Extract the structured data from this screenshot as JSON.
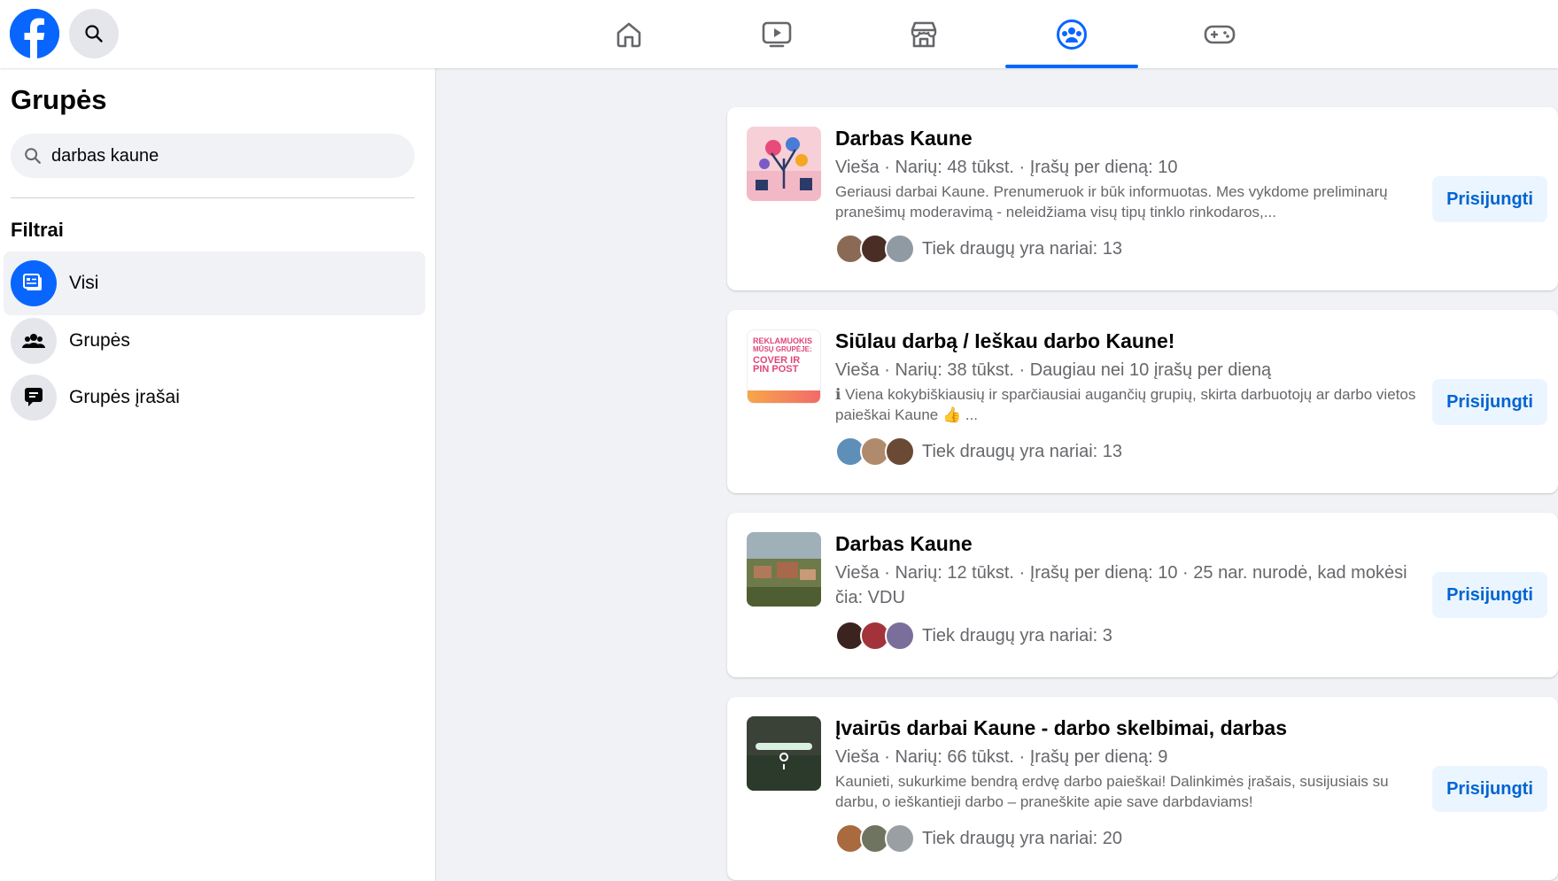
{
  "sidebar": {
    "title": "Grupės",
    "search_value": "darbas kaune",
    "filters_heading": "Filtrai",
    "items": [
      {
        "label": "Visi"
      },
      {
        "label": "Grupės"
      },
      {
        "label": "Grupės įrašai"
      }
    ]
  },
  "results": [
    {
      "title": "Darbas Kaune",
      "meta": "Vieša · Narių: 48 tūkst. · Įrašų per dieną: 10",
      "description": "Geriausi darbai Kaune. Prenumeruok ir būk informuotas. Mes vykdome preliminarų pranešimų moderavimą - neleidžiama visų tipų tinklo rinkodaros,...",
      "friends": "Tiek draugų yra nariai: 13",
      "join_label": "Prisijungti"
    },
    {
      "title": "Siūlau darbą / Ieškau darbo Kaune!",
      "meta": "Vieša · Narių: 38 tūkst. · Daugiau nei 10 įrašų per dieną",
      "description": "ℹ Viena kokybiškiausių ir sparčiausiai augančių grupių, skirta darbuotojų ar darbo vietos paieškai Kaune 👍 ...",
      "friends": "Tiek draugų yra nariai: 13",
      "join_label": "Prisijungti",
      "thumb_text": [
        "REKLAMUOKIS",
        "MŪSŲ GRUPĖJE:",
        "COVER IR",
        "PIN POST"
      ]
    },
    {
      "title": "Darbas Kaune",
      "meta": "Vieša · Narių: 12 tūkst. · Įrašų per dieną: 10 · 25 nar. nurodė, kad mokėsi čia: VDU",
      "friends": "Tiek draugų yra nariai: 3",
      "join_label": "Prisijungti"
    },
    {
      "title": "Įvairūs darbai Kaune - darbo skelbimai, darbas",
      "meta": "Vieša · Narių: 66 tūkst. · Įrašų per dieną: 9",
      "description": "Kaunieti, sukurkime bendrą erdvę darbo paieškai! Dalinkimės įrašais, susijusiais su darbu, o ieškantieji darbo – praneškite apie save darbdaviams!",
      "friends": "Tiek draugų yra nariai: 20",
      "join_label": "Prisijungti"
    }
  ],
  "icons": {
    "logo": "facebook-logo-icon",
    "top_search": "search-icon",
    "nav": [
      "home-icon",
      "video-icon",
      "marketplace-icon",
      "groups-icon",
      "gaming-icon"
    ]
  },
  "colors": {
    "accent": "#0866ff",
    "join_button_bg": "#ebf5ff",
    "join_button_text": "#0064d1",
    "page_bg": "#f0f2f5"
  }
}
